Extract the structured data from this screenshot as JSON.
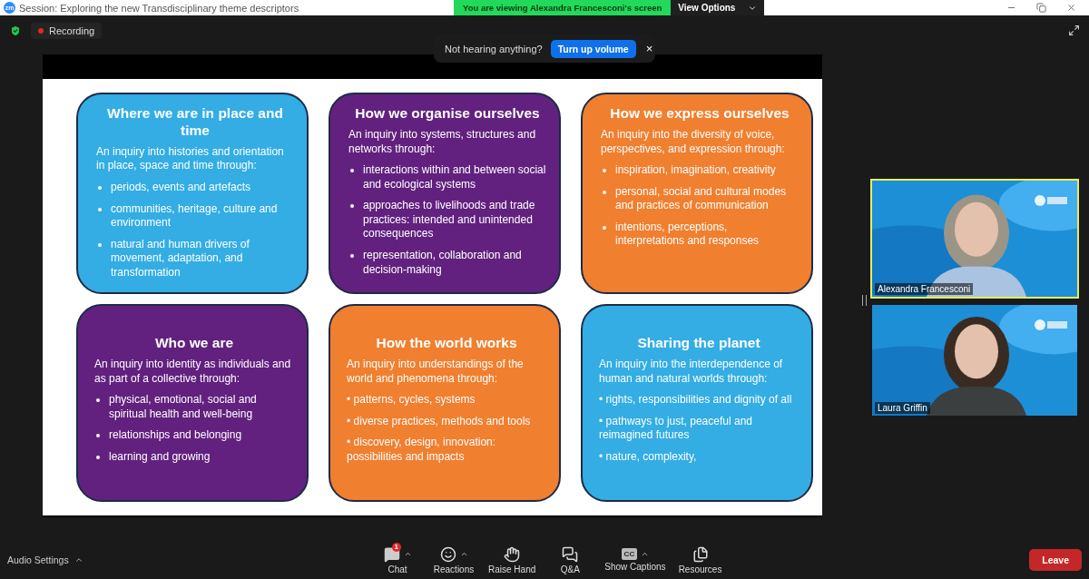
{
  "window": {
    "app_logo": "zm",
    "title": "Session: Exploring the new Transdisciplinary theme descriptors"
  },
  "share_banner": {
    "text": "You are viewing Alexandra Francesconi's screen",
    "button": "View Options"
  },
  "meeting_bar": {
    "recording": "Recording"
  },
  "notice": {
    "text": "Not hearing anything?",
    "button": "Turn up volume",
    "close": "×"
  },
  "slide": {
    "cards": [
      {
        "title": "Where we are in place and time",
        "color": "#33ade4",
        "intro": "An inquiry into histories and orientation in place, space and time through:",
        "kind": "hanging",
        "items": [
          "periods, events and artefacts",
          "communities, heritage, culture and environment",
          "natural and human drivers of movement, adaptation, and transformation"
        ]
      },
      {
        "title": "How we organise ourselves",
        "color": "#62217e",
        "intro": "An inquiry into systems, structures and networks through:",
        "kind": "hanging",
        "items": [
          "interactions within and between social and ecological systems",
          "approaches to livelihoods and trade practices: intended and unintended consequences",
          "representation, collaboration and decision-making"
        ]
      },
      {
        "title": "How we express ourselves",
        "color": "#f07f2f",
        "intro": "An inquiry into the diversity of voice, perspectives, and expression through:",
        "kind": "hanging",
        "items": [
          "inspiration, imagination, creativity",
          "personal, social and cultural modes and practices of communication",
          "intentions, perceptions, interpretations and responses"
        ]
      },
      {
        "title": "Who we are",
        "color": "#62217e",
        "intro": "An inquiry into identity as individuals and as part of a collective through:",
        "kind": "hanging",
        "items": [
          "physical, emotional, social and spiritual health and well-being",
          "relationships and belonging",
          "learning and growing"
        ]
      },
      {
        "title": "How the world works",
        "color": "#f07f2f",
        "intro": "An inquiry into understandings of the world and phenomena through:",
        "kind": "inline",
        "items": [
          "• patterns, cycles, systems",
          "• diverse practices, methods and tools",
          "• discovery, design, innovation: possibilities and impacts"
        ]
      },
      {
        "title": "Sharing the planet",
        "color": "#33ade4",
        "intro": "An inquiry into the interdependence of human and natural worlds through:",
        "kind": "inline",
        "items": [
          "• rights, responsibilities and dignity of all",
          "• pathways to just, peaceful and reimagined futures",
          "• nature, complexity,"
        ]
      }
    ]
  },
  "videos": [
    {
      "name": "Alexandra Francesconi",
      "active_speaker": true
    },
    {
      "name": "Laura Griffin",
      "active_speaker": false
    }
  ],
  "toolbar": {
    "audio": "Audio Settings",
    "buttons": [
      {
        "kind": "chat",
        "label": "Chat",
        "badge": "1",
        "menu": true
      },
      {
        "kind": "reactions",
        "label": "Reactions",
        "menu": true
      },
      {
        "kind": "hand",
        "label": "Raise Hand",
        "menu": false
      },
      {
        "kind": "qa",
        "label": "Q&A",
        "menu": false
      },
      {
        "kind": "captions",
        "label": "Show Captions",
        "glyph": "CC",
        "menu": true
      },
      {
        "kind": "resources",
        "label": "Resources",
        "menu": false
      }
    ],
    "leave": "Leave"
  }
}
